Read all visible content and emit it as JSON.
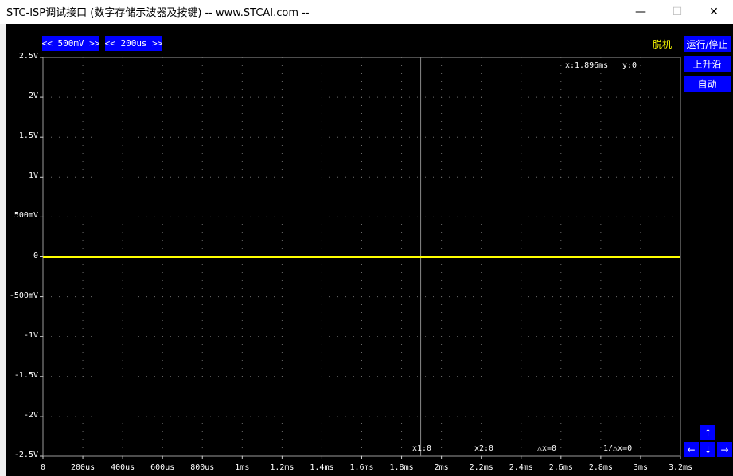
{
  "window": {
    "title": "STC-ISP调试接口 (数字存储示波器及按键) -- www.STCAI.com --",
    "min_glyph": "—",
    "max_glyph": "☐",
    "close_glyph": "✕"
  },
  "toolbar": {
    "volt_div": "<< 500mV >>",
    "time_div": "<< 200us >>",
    "status": "脱机",
    "run_stop": "运行/停止",
    "trigger_edge": "上升沿",
    "auto": "自动"
  },
  "arrows": {
    "up": "↑",
    "left": "←",
    "down": "↓",
    "right": "→"
  },
  "cursor": {
    "x_label": "x:1.896ms",
    "y_label": "y:0",
    "x_ms": 1.896
  },
  "measure": {
    "x1": "x1:0",
    "x2": "x2:0",
    "dx": "△x=0",
    "inv_dx": "1/△x=0"
  },
  "chart_data": {
    "type": "line",
    "y_ticks": [
      "2.5V",
      "2V",
      "1.5V",
      "1V",
      "500mV",
      "0",
      "-500mV",
      "-1V",
      "-1.5V",
      "-2V",
      "-2.5V"
    ],
    "x_ticks": [
      "0",
      "200us",
      "400us",
      "600us",
      "800us",
      "1ms",
      "1.2ms",
      "1.4ms",
      "1.6ms",
      "1.8ms",
      "2ms",
      "2.2ms",
      "2.4ms",
      "2.6ms",
      "2.8ms",
      "3ms",
      "3.2ms"
    ],
    "xlim_ms": [
      0,
      3.2
    ],
    "ylim_v": [
      -2.5,
      2.5
    ],
    "grid": true,
    "series": [
      {
        "color": "#ffff00",
        "x_ms": [
          0,
          3.2
        ],
        "y_v": [
          0,
          0
        ]
      }
    ]
  }
}
